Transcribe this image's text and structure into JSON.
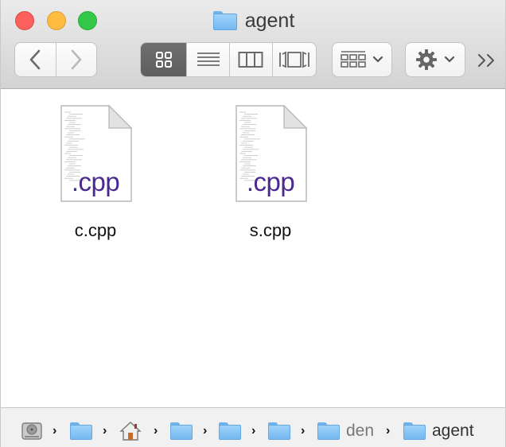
{
  "window": {
    "title": "agent"
  },
  "toolbar": {
    "back_icon": "chevron-left-icon",
    "forward_icon": "chevron-right-icon",
    "view_modes": [
      "icon-view",
      "list-view",
      "column-view",
      "cover-flow-view"
    ],
    "active_view": "icon-view",
    "arrange_icon": "grid-arrange-icon",
    "action_icon": "gear-icon",
    "overflow_label": "»"
  },
  "files": [
    {
      "name": "c.cpp",
      "ext_label": ".cpp"
    },
    {
      "name": "s.cpp",
      "ext_label": ".cpp"
    }
  ],
  "pathbar": {
    "items": [
      {
        "icon": "hard-drive-icon",
        "label": ""
      },
      {
        "icon": "user-folder-icon",
        "label": ""
      },
      {
        "icon": "home-icon",
        "label": ""
      },
      {
        "icon": "app-folder-icon",
        "label": ""
      },
      {
        "icon": "folder-icon",
        "label": ""
      },
      {
        "icon": "folder-icon",
        "label": ""
      },
      {
        "icon": "folder-icon",
        "label": "den"
      },
      {
        "icon": "folder-icon",
        "label": "agent"
      }
    ]
  },
  "colors": {
    "folder_blue": "#8cc8f7",
    "cpp_label": "#4b2a8f",
    "close": "#fc605c",
    "minimize": "#fdbc40",
    "maximize": "#34c84a"
  }
}
